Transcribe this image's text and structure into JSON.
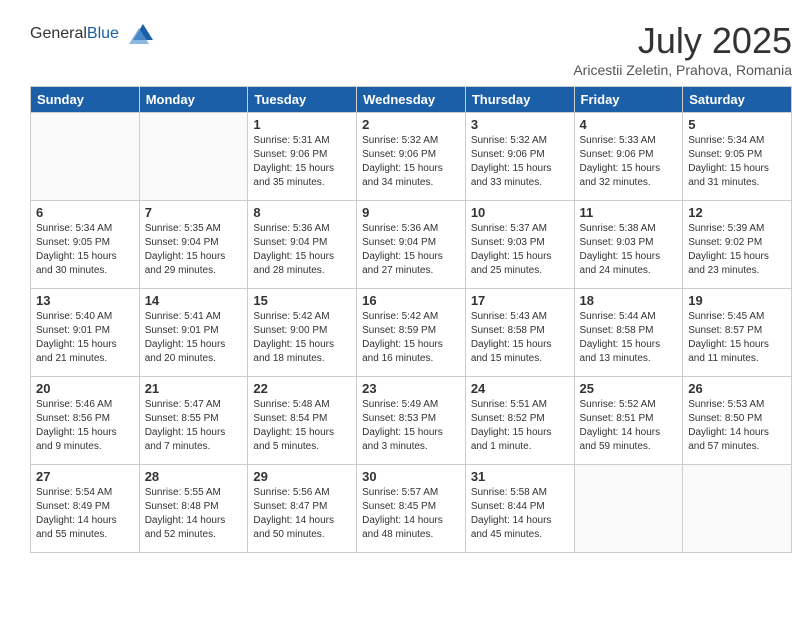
{
  "header": {
    "logo_general": "General",
    "logo_blue": "Blue",
    "month_title": "July 2025",
    "location": "Aricestii Zeletin, Prahova, Romania"
  },
  "columns": [
    "Sunday",
    "Monday",
    "Tuesday",
    "Wednesday",
    "Thursday",
    "Friday",
    "Saturday"
  ],
  "weeks": [
    [
      {
        "day": "",
        "info": ""
      },
      {
        "day": "",
        "info": ""
      },
      {
        "day": "1",
        "info": "Sunrise: 5:31 AM\nSunset: 9:06 PM\nDaylight: 15 hours\nand 35 minutes."
      },
      {
        "day": "2",
        "info": "Sunrise: 5:32 AM\nSunset: 9:06 PM\nDaylight: 15 hours\nand 34 minutes."
      },
      {
        "day": "3",
        "info": "Sunrise: 5:32 AM\nSunset: 9:06 PM\nDaylight: 15 hours\nand 33 minutes."
      },
      {
        "day": "4",
        "info": "Sunrise: 5:33 AM\nSunset: 9:06 PM\nDaylight: 15 hours\nand 32 minutes."
      },
      {
        "day": "5",
        "info": "Sunrise: 5:34 AM\nSunset: 9:05 PM\nDaylight: 15 hours\nand 31 minutes."
      }
    ],
    [
      {
        "day": "6",
        "info": "Sunrise: 5:34 AM\nSunset: 9:05 PM\nDaylight: 15 hours\nand 30 minutes."
      },
      {
        "day": "7",
        "info": "Sunrise: 5:35 AM\nSunset: 9:04 PM\nDaylight: 15 hours\nand 29 minutes."
      },
      {
        "day": "8",
        "info": "Sunrise: 5:36 AM\nSunset: 9:04 PM\nDaylight: 15 hours\nand 28 minutes."
      },
      {
        "day": "9",
        "info": "Sunrise: 5:36 AM\nSunset: 9:04 PM\nDaylight: 15 hours\nand 27 minutes."
      },
      {
        "day": "10",
        "info": "Sunrise: 5:37 AM\nSunset: 9:03 PM\nDaylight: 15 hours\nand 25 minutes."
      },
      {
        "day": "11",
        "info": "Sunrise: 5:38 AM\nSunset: 9:03 PM\nDaylight: 15 hours\nand 24 minutes."
      },
      {
        "day": "12",
        "info": "Sunrise: 5:39 AM\nSunset: 9:02 PM\nDaylight: 15 hours\nand 23 minutes."
      }
    ],
    [
      {
        "day": "13",
        "info": "Sunrise: 5:40 AM\nSunset: 9:01 PM\nDaylight: 15 hours\nand 21 minutes."
      },
      {
        "day": "14",
        "info": "Sunrise: 5:41 AM\nSunset: 9:01 PM\nDaylight: 15 hours\nand 20 minutes."
      },
      {
        "day": "15",
        "info": "Sunrise: 5:42 AM\nSunset: 9:00 PM\nDaylight: 15 hours\nand 18 minutes."
      },
      {
        "day": "16",
        "info": "Sunrise: 5:42 AM\nSunset: 8:59 PM\nDaylight: 15 hours\nand 16 minutes."
      },
      {
        "day": "17",
        "info": "Sunrise: 5:43 AM\nSunset: 8:58 PM\nDaylight: 15 hours\nand 15 minutes."
      },
      {
        "day": "18",
        "info": "Sunrise: 5:44 AM\nSunset: 8:58 PM\nDaylight: 15 hours\nand 13 minutes."
      },
      {
        "day": "19",
        "info": "Sunrise: 5:45 AM\nSunset: 8:57 PM\nDaylight: 15 hours\nand 11 minutes."
      }
    ],
    [
      {
        "day": "20",
        "info": "Sunrise: 5:46 AM\nSunset: 8:56 PM\nDaylight: 15 hours\nand 9 minutes."
      },
      {
        "day": "21",
        "info": "Sunrise: 5:47 AM\nSunset: 8:55 PM\nDaylight: 15 hours\nand 7 minutes."
      },
      {
        "day": "22",
        "info": "Sunrise: 5:48 AM\nSunset: 8:54 PM\nDaylight: 15 hours\nand 5 minutes."
      },
      {
        "day": "23",
        "info": "Sunrise: 5:49 AM\nSunset: 8:53 PM\nDaylight: 15 hours\nand 3 minutes."
      },
      {
        "day": "24",
        "info": "Sunrise: 5:51 AM\nSunset: 8:52 PM\nDaylight: 15 hours\nand 1 minute."
      },
      {
        "day": "25",
        "info": "Sunrise: 5:52 AM\nSunset: 8:51 PM\nDaylight: 14 hours\nand 59 minutes."
      },
      {
        "day": "26",
        "info": "Sunrise: 5:53 AM\nSunset: 8:50 PM\nDaylight: 14 hours\nand 57 minutes."
      }
    ],
    [
      {
        "day": "27",
        "info": "Sunrise: 5:54 AM\nSunset: 8:49 PM\nDaylight: 14 hours\nand 55 minutes."
      },
      {
        "day": "28",
        "info": "Sunrise: 5:55 AM\nSunset: 8:48 PM\nDaylight: 14 hours\nand 52 minutes."
      },
      {
        "day": "29",
        "info": "Sunrise: 5:56 AM\nSunset: 8:47 PM\nDaylight: 14 hours\nand 50 minutes."
      },
      {
        "day": "30",
        "info": "Sunrise: 5:57 AM\nSunset: 8:45 PM\nDaylight: 14 hours\nand 48 minutes."
      },
      {
        "day": "31",
        "info": "Sunrise: 5:58 AM\nSunset: 8:44 PM\nDaylight: 14 hours\nand 45 minutes."
      },
      {
        "day": "",
        "info": ""
      },
      {
        "day": "",
        "info": ""
      }
    ]
  ]
}
